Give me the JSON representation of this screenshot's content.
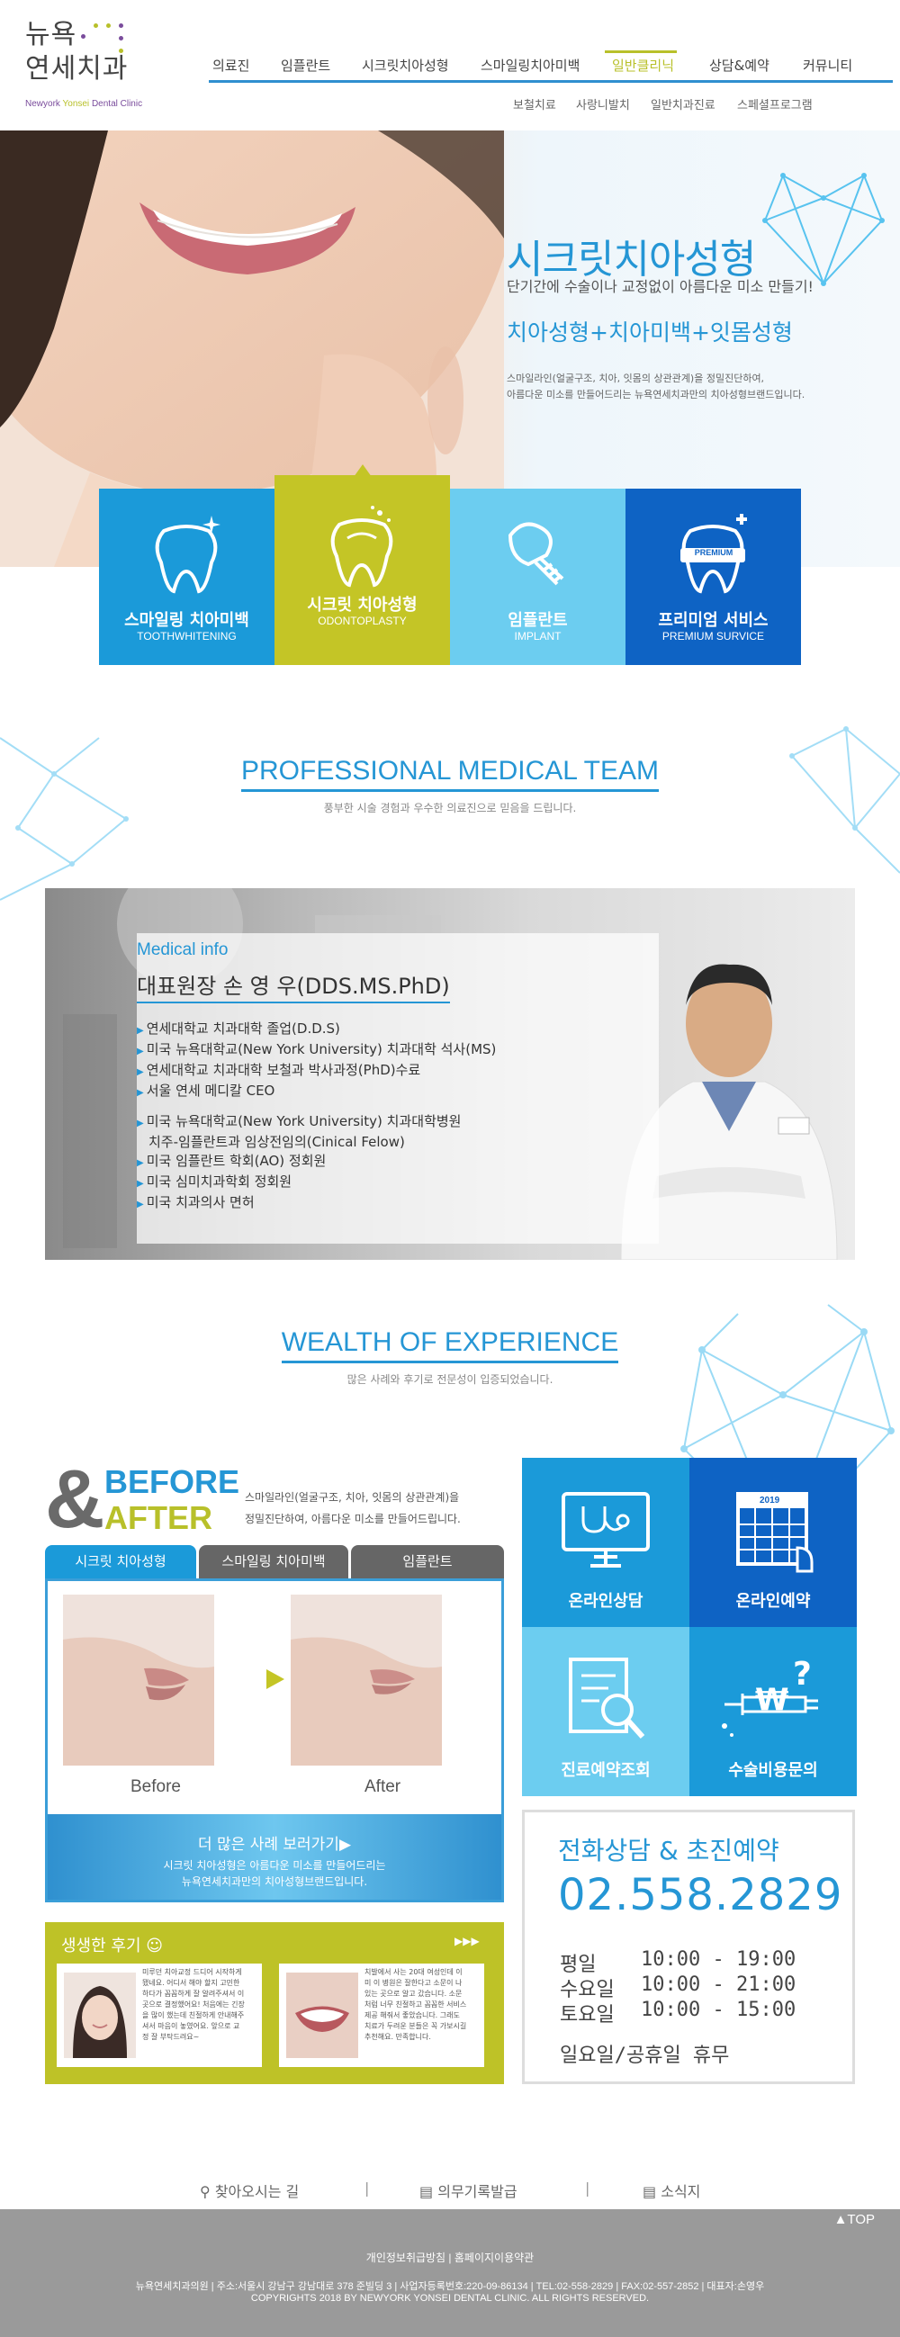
{
  "header": {
    "logo_line1": "뉴욕",
    "logo_line2": "연세치과",
    "logo_en_prefix": "Newyork ",
    "logo_en_mid": "Yonsei",
    "logo_en_suffix": " Dental Clinic",
    "nav": [
      "의료진",
      "임플란트",
      "시크릿치아성형",
      "스마일링치아미백",
      "일반클리닉",
      "상담&예약",
      "커뮤니티"
    ],
    "active_nav": "일반클리닉",
    "subnav": [
      "보철치료",
      "사랑니발치",
      "일반치과진료",
      "스페셜프로그램"
    ]
  },
  "hero": {
    "title": "시크릿치아성형",
    "subtitle": "단기간에 수술이나 교정없이 아름다운 미소 만들기!",
    "tagline": "치아성형+치아미백+잇몸성형",
    "desc1": "스마일라인(얼굴구조, 치아, 잇몸의 상관관계)을 정밀진단하여,",
    "desc2": "아름다운 미소를 만들어드리는 뉴욕연세치과만의 치아성형브랜드입니다."
  },
  "services": [
    {
      "ko": "스마일링 치아미백",
      "en": "TOOTHWHITENING",
      "color": "#1b9ad9"
    },
    {
      "ko": "시크릿 치아성형",
      "en": "ODONTOPLASTY",
      "color": "#c4c526"
    },
    {
      "ko": "임플란트",
      "en": "IMPLANT",
      "color": "#6ccdf0"
    },
    {
      "ko": "프리미엄 서비스",
      "en": "PREMIUM SURVICE",
      "color": "#0e63c4",
      "badge": "PREMIUM"
    }
  ],
  "team": {
    "title": "PROFESSIONAL MEDICAL TEAM",
    "subtitle": "풍부한 시술 경험과 우수한 의료진으로 믿음을 드립니다.",
    "info_label": "Medical info",
    "doctor_name": "대표원장 손 영 우(DDS.MS.PhD)",
    "career1": [
      "연세대학교 치과대학 졸업(D.D.S)",
      "미국 뉴욕대학교(New York University) 치과대학 석사(MS)",
      "연세대학교 치과대학 보철과 박사과정(PhD)수료",
      "서울 연세 메디칼 CEO"
    ],
    "career2_first": "미국 뉴욕대학교(New York University) 치과대학병원",
    "career2_cont": "치주-임플란트과 임상전임의(Cinical Felow)",
    "career2": [
      "미국 임플란트 학회(AO) 정회원",
      "미국 심미치과학회 정회원",
      "미국 치과의사 면허"
    ]
  },
  "experience": {
    "title": "WEALTH OF EXPERIENCE",
    "subtitle": "많은 사례와 후기로 전문성이 입증되었습니다.",
    "ba_before": "BEFORE",
    "ba_after": "AFTER",
    "ba_desc1": "스마일라인(얼굴구조, 치아, 잇몸의 상관관계)을",
    "ba_desc2": "정밀진단하여, 아름다운 미소를 만들어드립니다.",
    "tabs": [
      "시크릿 치아성형",
      "스마일링 치아미백",
      "임플란트"
    ],
    "active_tab": 0,
    "label_before": "Before",
    "label_after": "After",
    "more_label": "더 많은 사례 보러가기▶",
    "more_desc1": "시크릿 치아성형은 아름다운 미소를 만들어드리는",
    "more_desc2": "뉴욕연세치과만의 치아성형브랜드입니다.",
    "review_title": "생생한 후기",
    "review_more": "▶▶▶",
    "reviews": [
      "미루던 치아교정 드디어 시작하게 됐네요. 어디서 해야 할지 고민한 하다가 꼼꼼하게 잘 알려주셔서 이 곳으로 결정했어요! 처음에는 긴장을 많이 했는데 친절하게 안내해주셔서 마음이 놓였어요. 앞으로 교정 잘 부탁드려요~",
      "치발에서 사는 20대 여성인데 이미 이 병원은 잘한다고 소문이 나있는 곳으로 알고 갔습니다. 소문처럼 너무 친절하고 꼼꼼한 서비스 제공 해줘서 좋았습니다. 그래도 치료가 두려운 분들은 꼭 가보시길 추천해요. 만족합니다."
    ],
    "quick": [
      "온라인상담",
      "온라인예약",
      "진료예약조회",
      "수술비용문의"
    ],
    "calendar_year": "2019",
    "call_title": "전화상담 & 초진예약",
    "call_number": "02.558.2829",
    "hours": [
      {
        "day": "평일",
        "time": "10:00 - 19:00"
      },
      {
        "day": "수요일",
        "time": "10:00 - 21:00"
      },
      {
        "day": "토요일",
        "time": "10:00 - 15:00"
      }
    ],
    "closed": "일요일/공휴일 휴무"
  },
  "footer": {
    "links": [
      "찾아오시는 길",
      "의무기록발급",
      "소식지"
    ],
    "top_label": "TOP",
    "policy": "개인정보취급방침 | 홈페이지이용약관",
    "info": "뉴욕연세치과의원 | 주소:서울시 강남구 강남대로 378 준빌딩 3 | 사업자등록번호:220-09-86134 | TEL:02-558-2829 | FAX:02-557-2852 | 대표자:손영우",
    "copyright": "COPYRIGHTS 2018 BY NEWYORK YONSEI DENTAL CLINIC. ALL RIGHTS RESERVED."
  },
  "colors": {
    "primary_blue": "#2596d5",
    "olive": "#b8c02a",
    "dark_blue": "#0e63c4",
    "light_blue": "#6ccdf0"
  }
}
